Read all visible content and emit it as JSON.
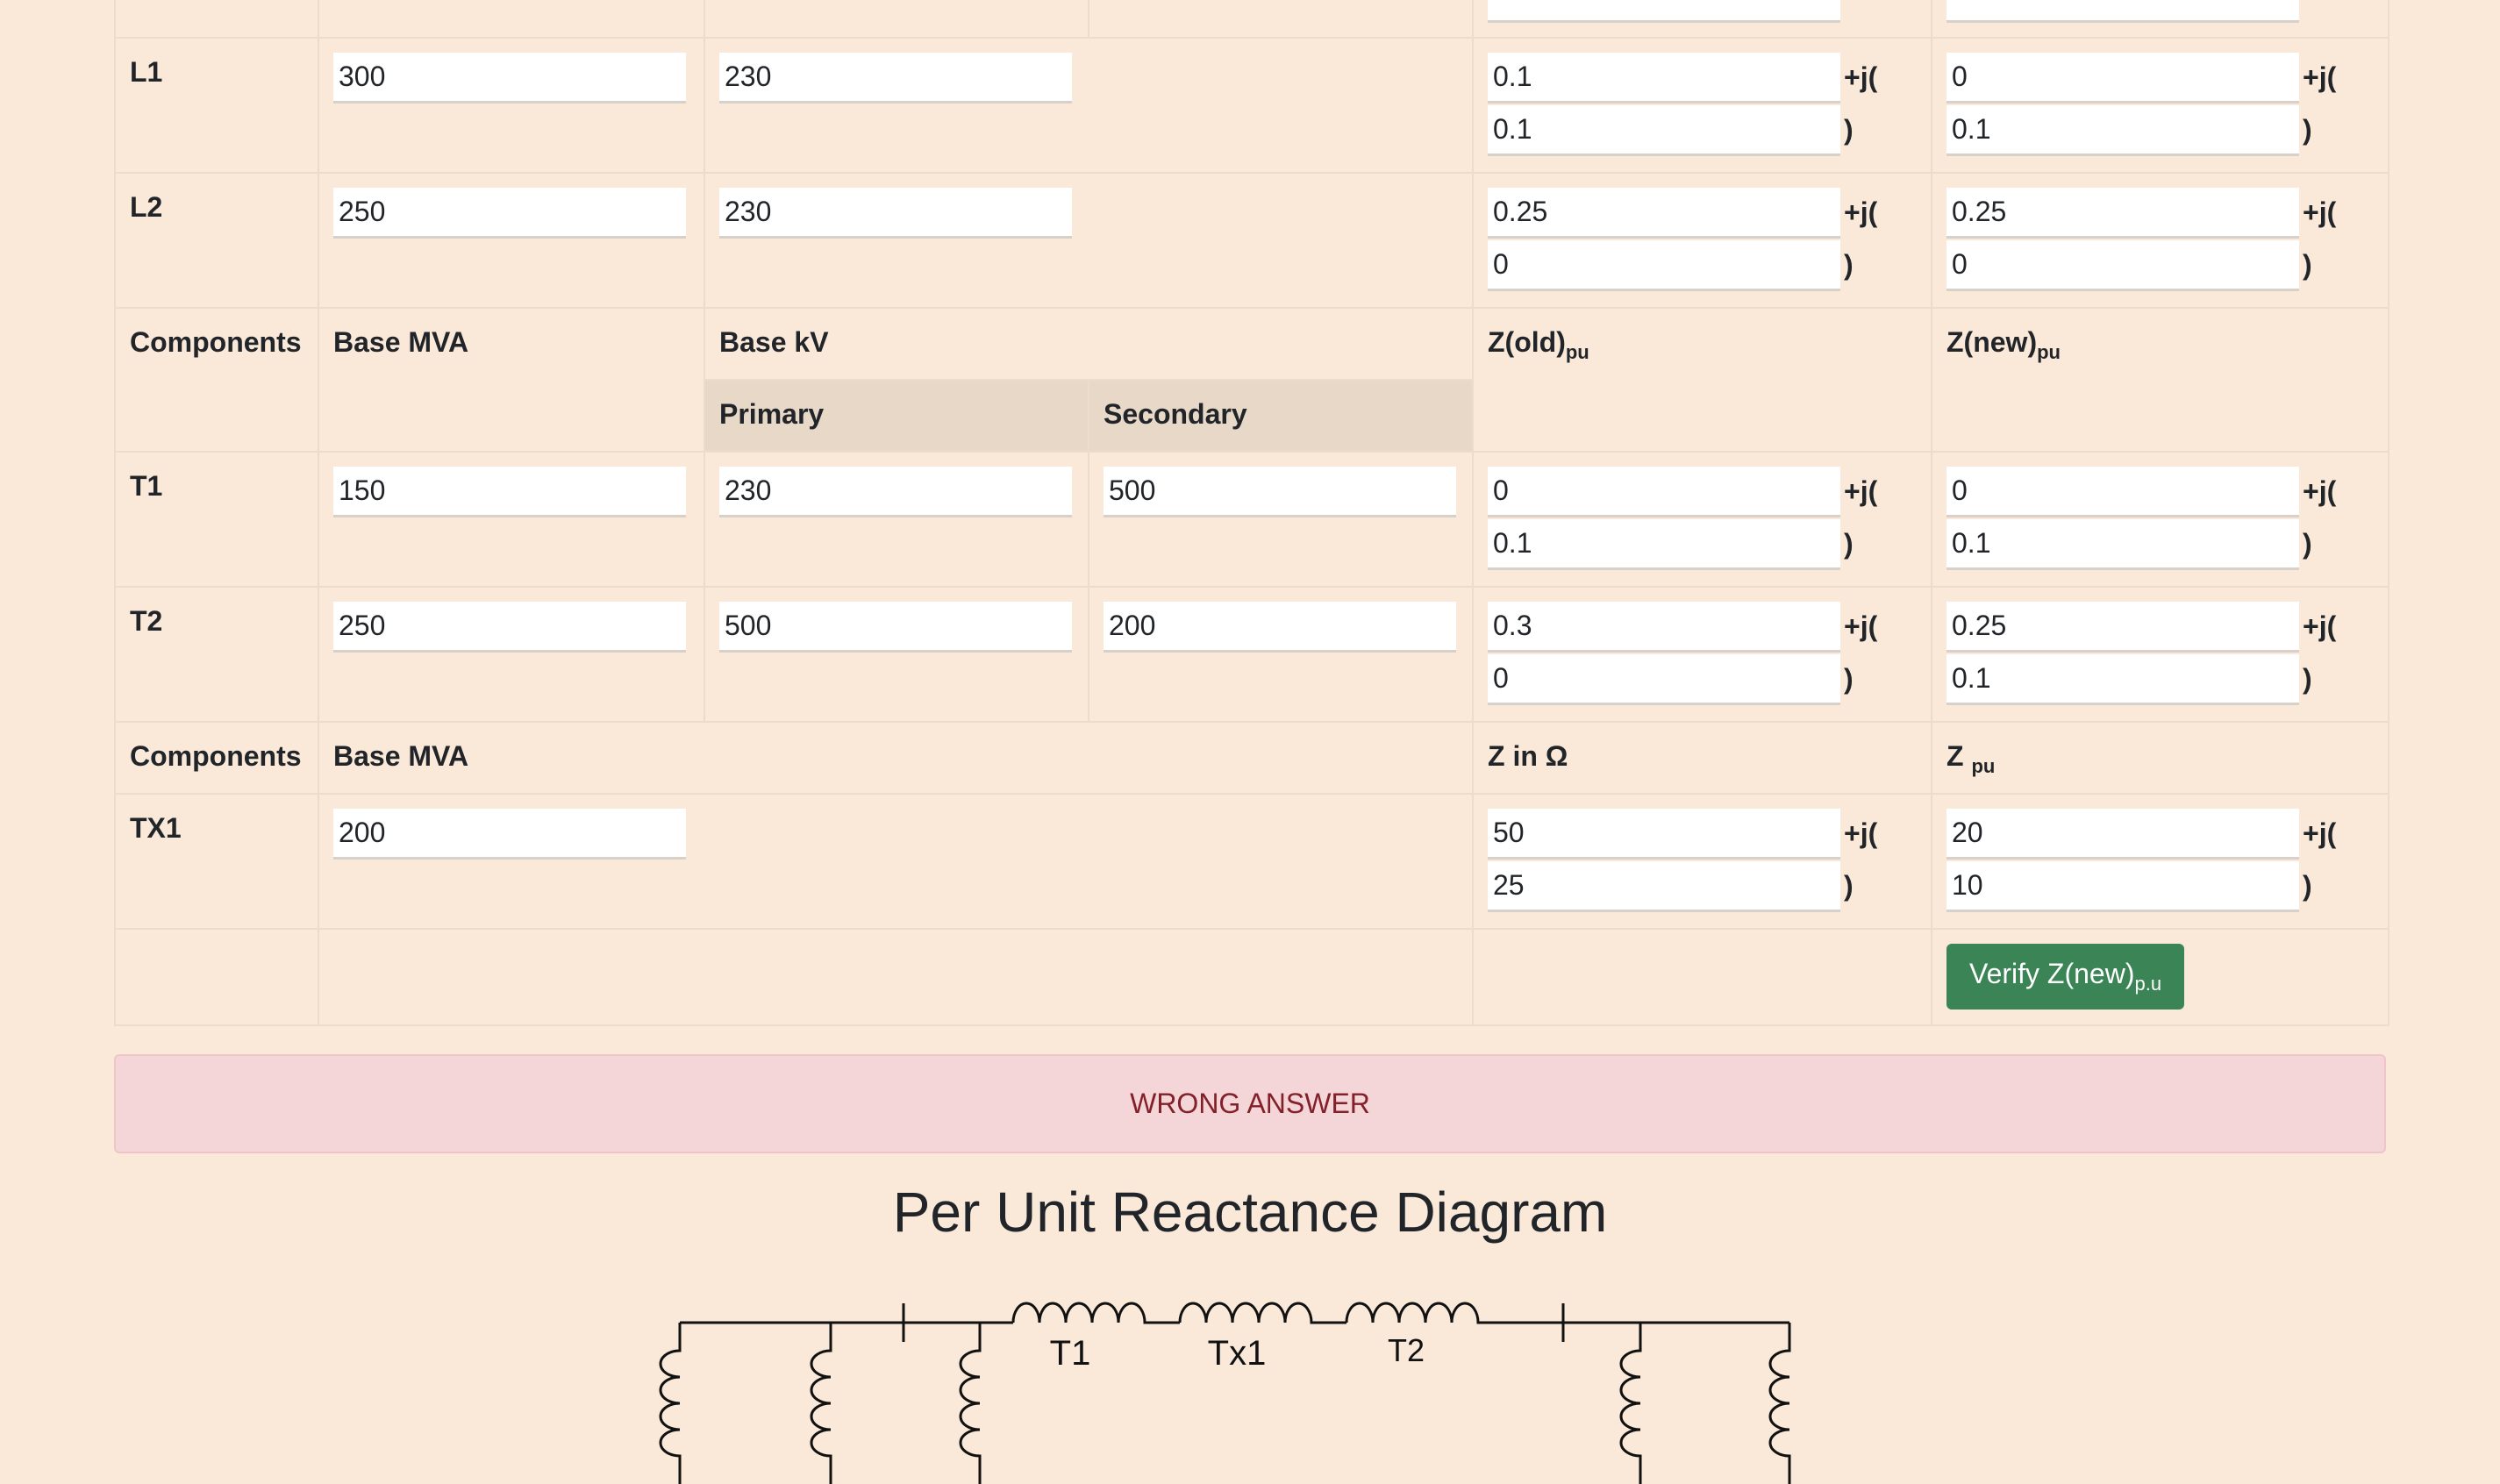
{
  "rows_top": [
    {
      "name": "L1",
      "mva": "300",
      "kv": "230",
      "old_re": "0.1",
      "old_im": "0.1",
      "new_re": "0",
      "new_im": "0.1"
    },
    {
      "name": "L2",
      "mva": "250",
      "kv": "230",
      "old_re": "0.25",
      "old_im": "0",
      "new_re": "0.25",
      "new_im": "0"
    }
  ],
  "header_tx": {
    "components": "Components",
    "base_mva": "Base MVA",
    "base_kv": "Base kV",
    "z_old": "Z(old)",
    "z_new": "Z(new)",
    "pu": "pu",
    "primary": "Primary",
    "secondary": "Secondary"
  },
  "rows_tx": [
    {
      "name": "T1",
      "mva": "150",
      "prim": "230",
      "sec": "500",
      "old_re": "0",
      "old_im": "0.1",
      "new_re": "0",
      "new_im": "0.1"
    },
    {
      "name": "T2",
      "mva": "250",
      "prim": "500",
      "sec": "200",
      "old_re": "0.3",
      "old_im": "0",
      "new_re": "0.25",
      "new_im": "0.1"
    }
  ],
  "header_line": {
    "components": "Components",
    "base_mva": "Base MVA",
    "z_ohm": "Z in Ω",
    "z_pu": "Z",
    "pu": "pu"
  },
  "row_line": {
    "name": "TX1",
    "mva": "200",
    "ohm_re": "50",
    "ohm_im": "25",
    "pu_re": "20",
    "pu_im": "10"
  },
  "suffix_plus_j": "+j(",
  "suffix_close": ")",
  "verify_button": {
    "label": "Verify Z(new)",
    "sub": "p.u"
  },
  "alert": "WRONG ANSWER",
  "diagram": {
    "title": "Per Unit Reactance Diagram",
    "labels": [
      "T1",
      "Tx1",
      "T2"
    ]
  }
}
